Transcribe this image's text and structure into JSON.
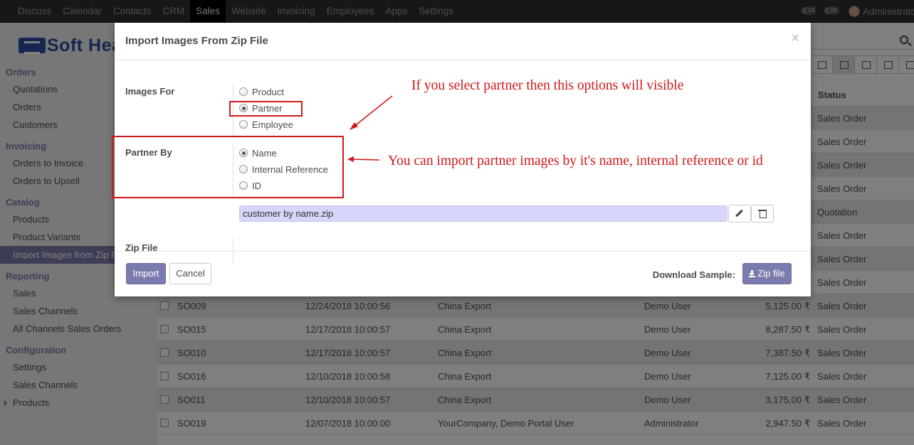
{
  "topbar": {
    "menu": [
      "Discuss",
      "Calendar",
      "Contacts",
      "CRM",
      "Sales",
      "Website",
      "Invoicing",
      "Employees",
      "Apps",
      "Settings"
    ],
    "active": "Sales",
    "activity_count": "14",
    "message_count": "20",
    "user": "Administrator"
  },
  "sidebar": {
    "logo_text": "Soft Hea",
    "sections": [
      {
        "title": "Orders",
        "items": [
          "Quotations",
          "Orders",
          "Customers"
        ]
      },
      {
        "title": "Invoicing",
        "items": [
          "Orders to Invoice",
          "Orders to Upsell"
        ]
      },
      {
        "title": "Catalog",
        "items": [
          "Products",
          "Product Variants",
          "Import Images from Zip F"
        ]
      },
      {
        "title": "Reporting",
        "items": [
          "Sales",
          "Sales Channels",
          "All Channels Sales Orders"
        ]
      },
      {
        "title": "Configuration",
        "items": [
          "Settings",
          "Sales Channels",
          "Products"
        ]
      }
    ]
  },
  "list": {
    "status_header": "Status",
    "hidden_status": [
      "Sales Order",
      "Sales Order",
      "Sales Order",
      "Sales Order",
      "Quotation",
      "Sales Order",
      "Sales Order",
      "Sales Order"
    ],
    "rows": [
      {
        "number": "SO009",
        "date": "12/24/2018 10:00:56",
        "customer": "China Export",
        "salesperson": "Demo User",
        "total": "5,125.00 ₹",
        "status": "Sales Order"
      },
      {
        "number": "SO015",
        "date": "12/17/2018 10:00:57",
        "customer": "China Export",
        "salesperson": "Demo User",
        "total": "8,287.50 ₹",
        "status": "Sales Order"
      },
      {
        "number": "SO010",
        "date": "12/17/2018 10:00:57",
        "customer": "China Export",
        "salesperson": "Demo User",
        "total": "7,387.50 ₹",
        "status": "Sales Order"
      },
      {
        "number": "SO016",
        "date": "12/10/2018 10:00:58",
        "customer": "China Export",
        "salesperson": "Demo User",
        "total": "7,125.00 ₹",
        "status": "Sales Order"
      },
      {
        "number": "SO011",
        "date": "12/10/2018 10:00:57",
        "customer": "China Export",
        "salesperson": "Demo User",
        "total": "3,175.00 ₹",
        "status": "Sales Order"
      },
      {
        "number": "SO019",
        "date": "12/07/2018 10:00:00",
        "customer": "YourCompany, Demo Portal User",
        "salesperson": "Administrator",
        "total": "2,947.50 ₹",
        "status": "Sales Order"
      }
    ]
  },
  "modal": {
    "title": "Import Images From Zip File",
    "close": "×",
    "images_for_label": "Images For",
    "images_for_options": [
      "Product",
      "Partner",
      "Employee"
    ],
    "images_for_selected": "Partner",
    "partner_by_label": "Partner By",
    "partner_by_options": [
      "Name",
      "Internal Reference",
      "ID"
    ],
    "partner_by_selected": "Name",
    "zip_label": "Zip File",
    "zip_value": "customer by name.zip",
    "import_button": "Import",
    "cancel_button": "Cancel",
    "download_label": "Download Sample:",
    "zip_button": "Zip file"
  },
  "annotations": {
    "top": "If you select partner then this options will visible",
    "side": "You can import partner images by it's name, internal reference or id"
  },
  "colors": {
    "accent": "#7c7bad",
    "annotation": "#d01818",
    "topbar": "#2e2e2e"
  },
  "icons": [
    "search-icon",
    "kanban-icon",
    "list-icon",
    "calendar-icon",
    "grid-icon",
    "graph-icon",
    "pencil-icon",
    "trash-icon",
    "download-icon"
  ]
}
